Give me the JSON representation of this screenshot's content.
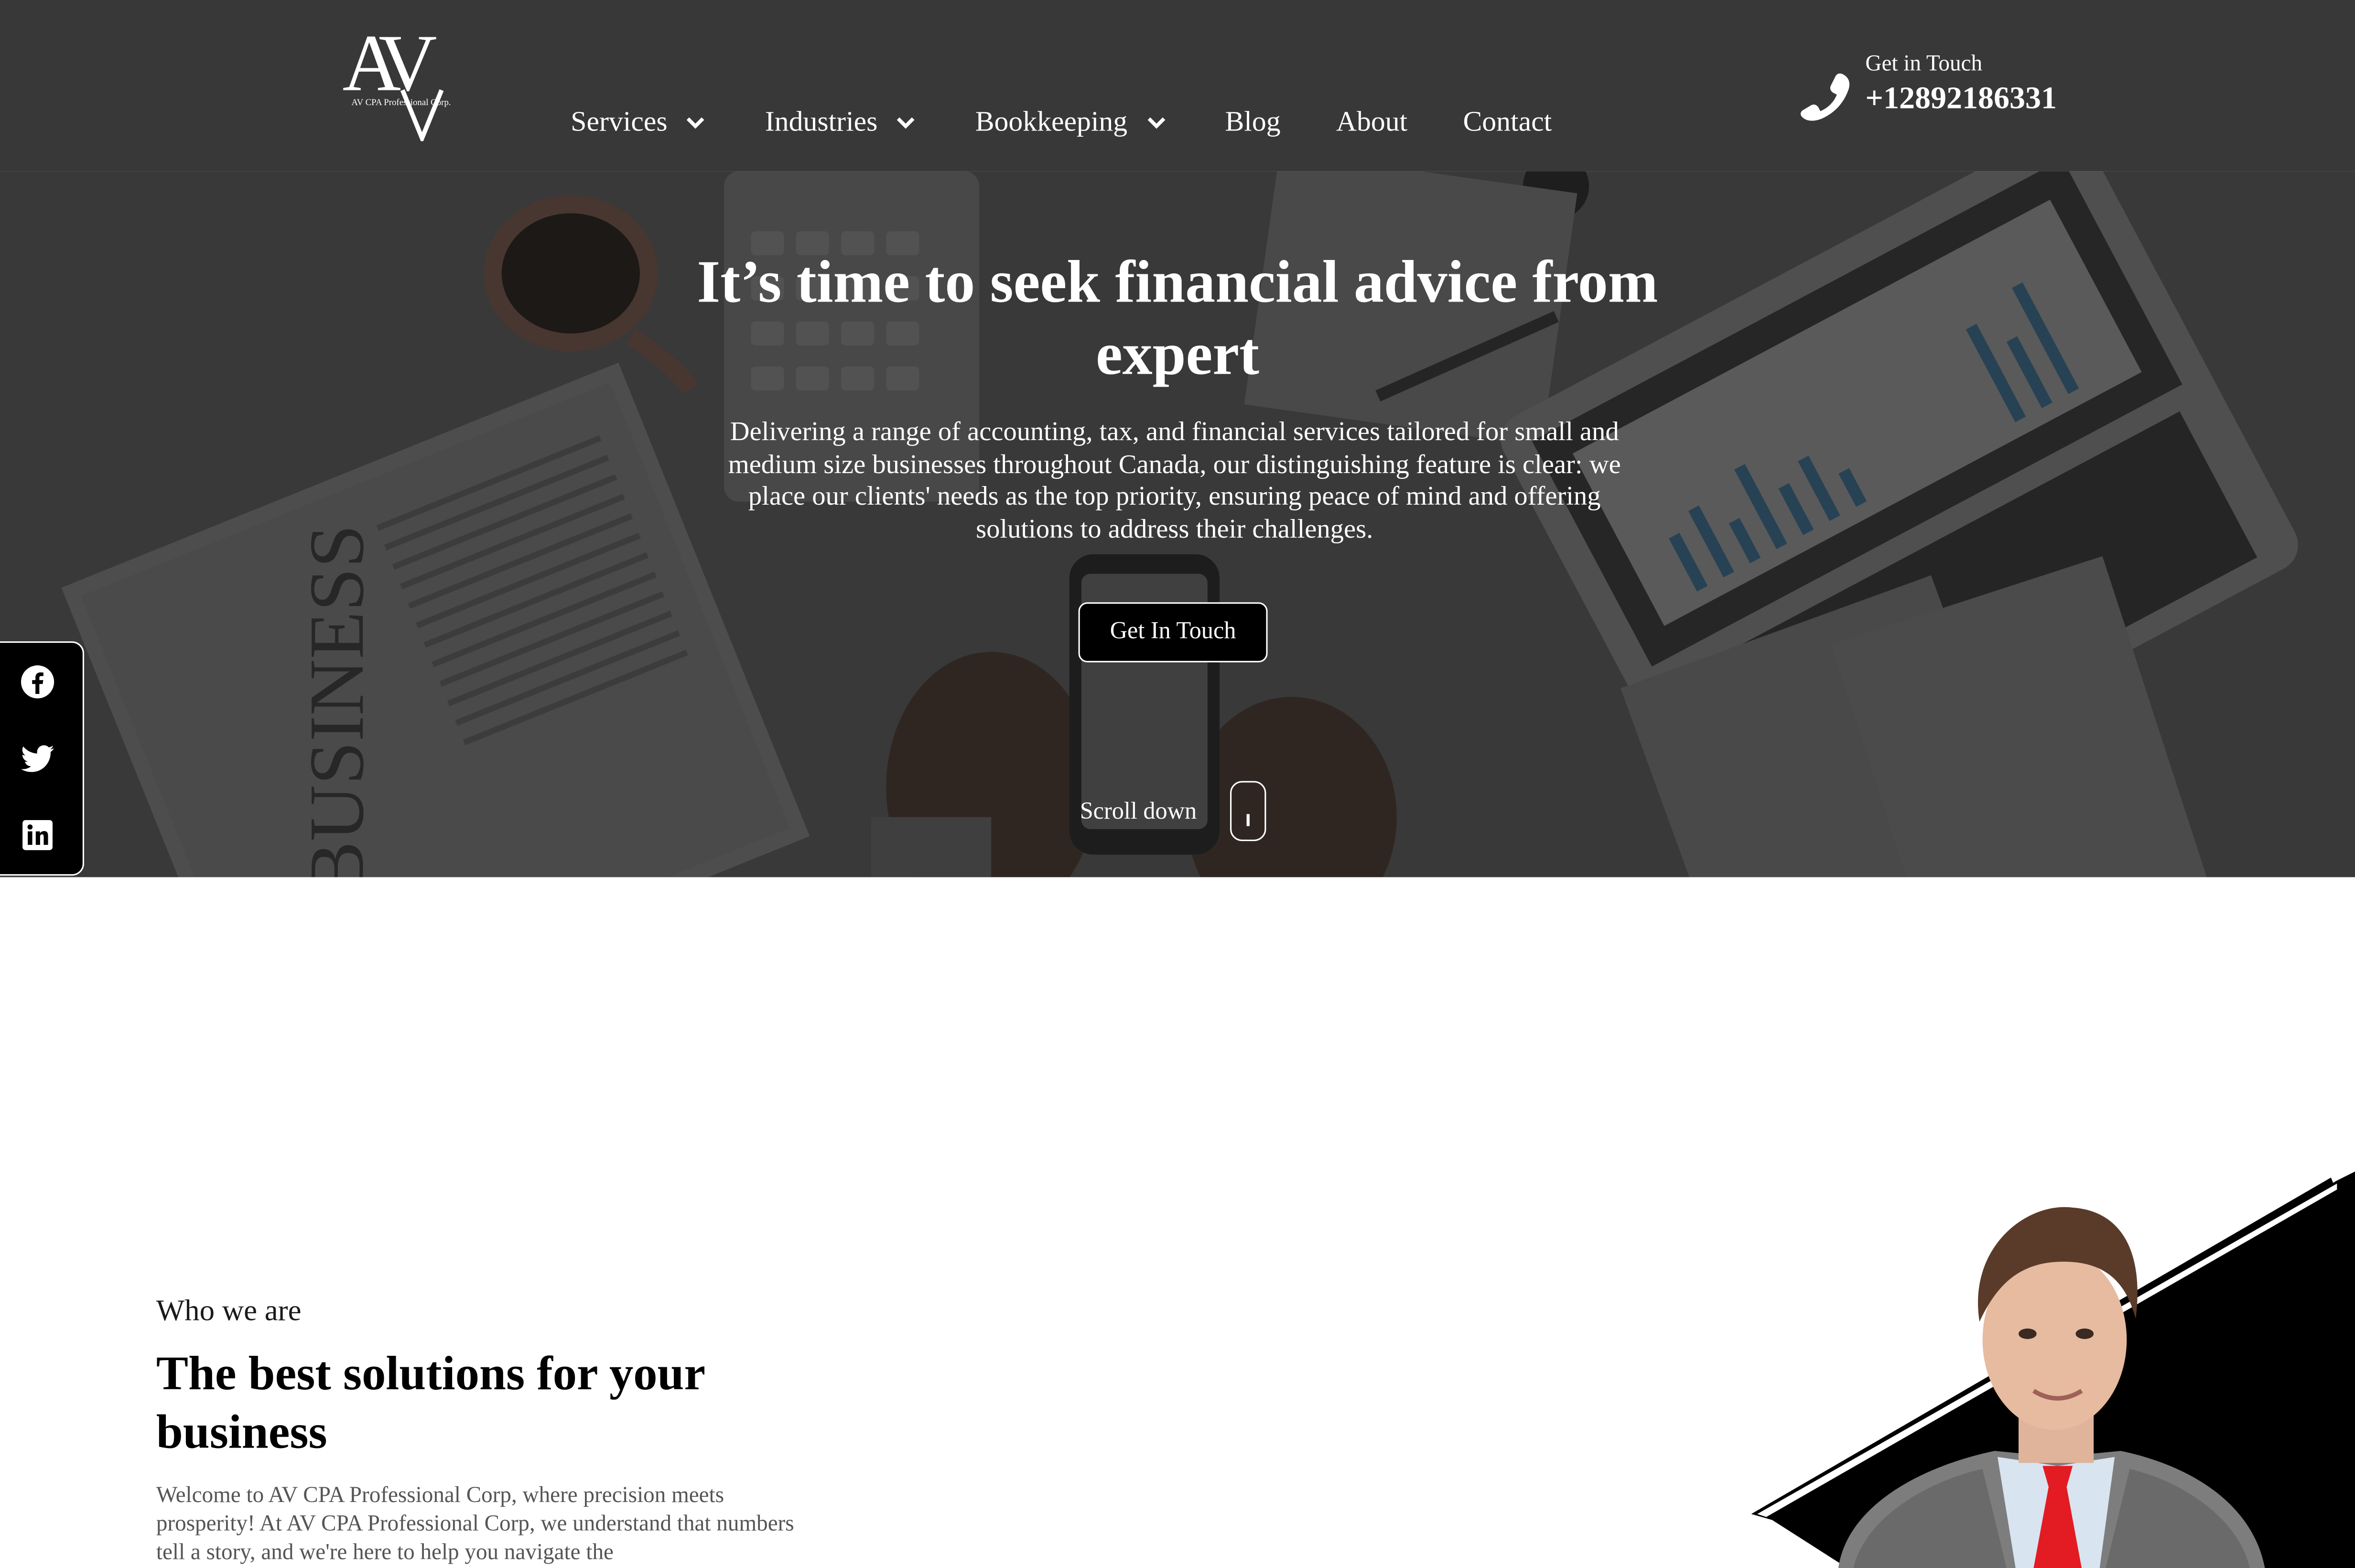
{
  "logo": {
    "mark": "AV",
    "subtitle": "AV CPA Professional Corp."
  },
  "nav": {
    "items": [
      {
        "label": "Services",
        "has_dropdown": true
      },
      {
        "label": "Industries",
        "has_dropdown": true
      },
      {
        "label": "Bookkeeping",
        "has_dropdown": true
      },
      {
        "label": "Blog",
        "has_dropdown": false
      },
      {
        "label": "About",
        "has_dropdown": false
      },
      {
        "label": "Contact",
        "has_dropdown": false
      }
    ]
  },
  "contact": {
    "label": "Get in Touch",
    "phone": "+12892186331",
    "icon": "phone-icon"
  },
  "hero": {
    "title": "It’s time to seek financial advice from expert",
    "description": "Delivering a range of accounting, tax, and financial services tailored for small and medium size businesses throughout Canada, our distinguishing feature is clear: we place our clients' needs as the top priority, ensuring peace of mind and offering solutions to address their challenges.",
    "cta_label": "Get In Touch",
    "scroll_label": "Scroll down",
    "newspaper_text": "BUSINESS"
  },
  "social": {
    "icons": [
      "facebook-icon",
      "twitter-icon",
      "linkedin-icon"
    ]
  },
  "about": {
    "eyebrow": "Who we are",
    "title": "The best solutions for your business",
    "text": "Welcome to AV CPA Professional Corp, where precision meets prosperity! At AV CPA Professional Corp, we understand that numbers tell a story, and we're here to help you navigate the"
  },
  "colors": {
    "header_bg": "#383838",
    "hero_overlay": "#2e2e2e",
    "accent": "#000000",
    "tie": "#e31b23",
    "text_white": "#ffffff"
  }
}
